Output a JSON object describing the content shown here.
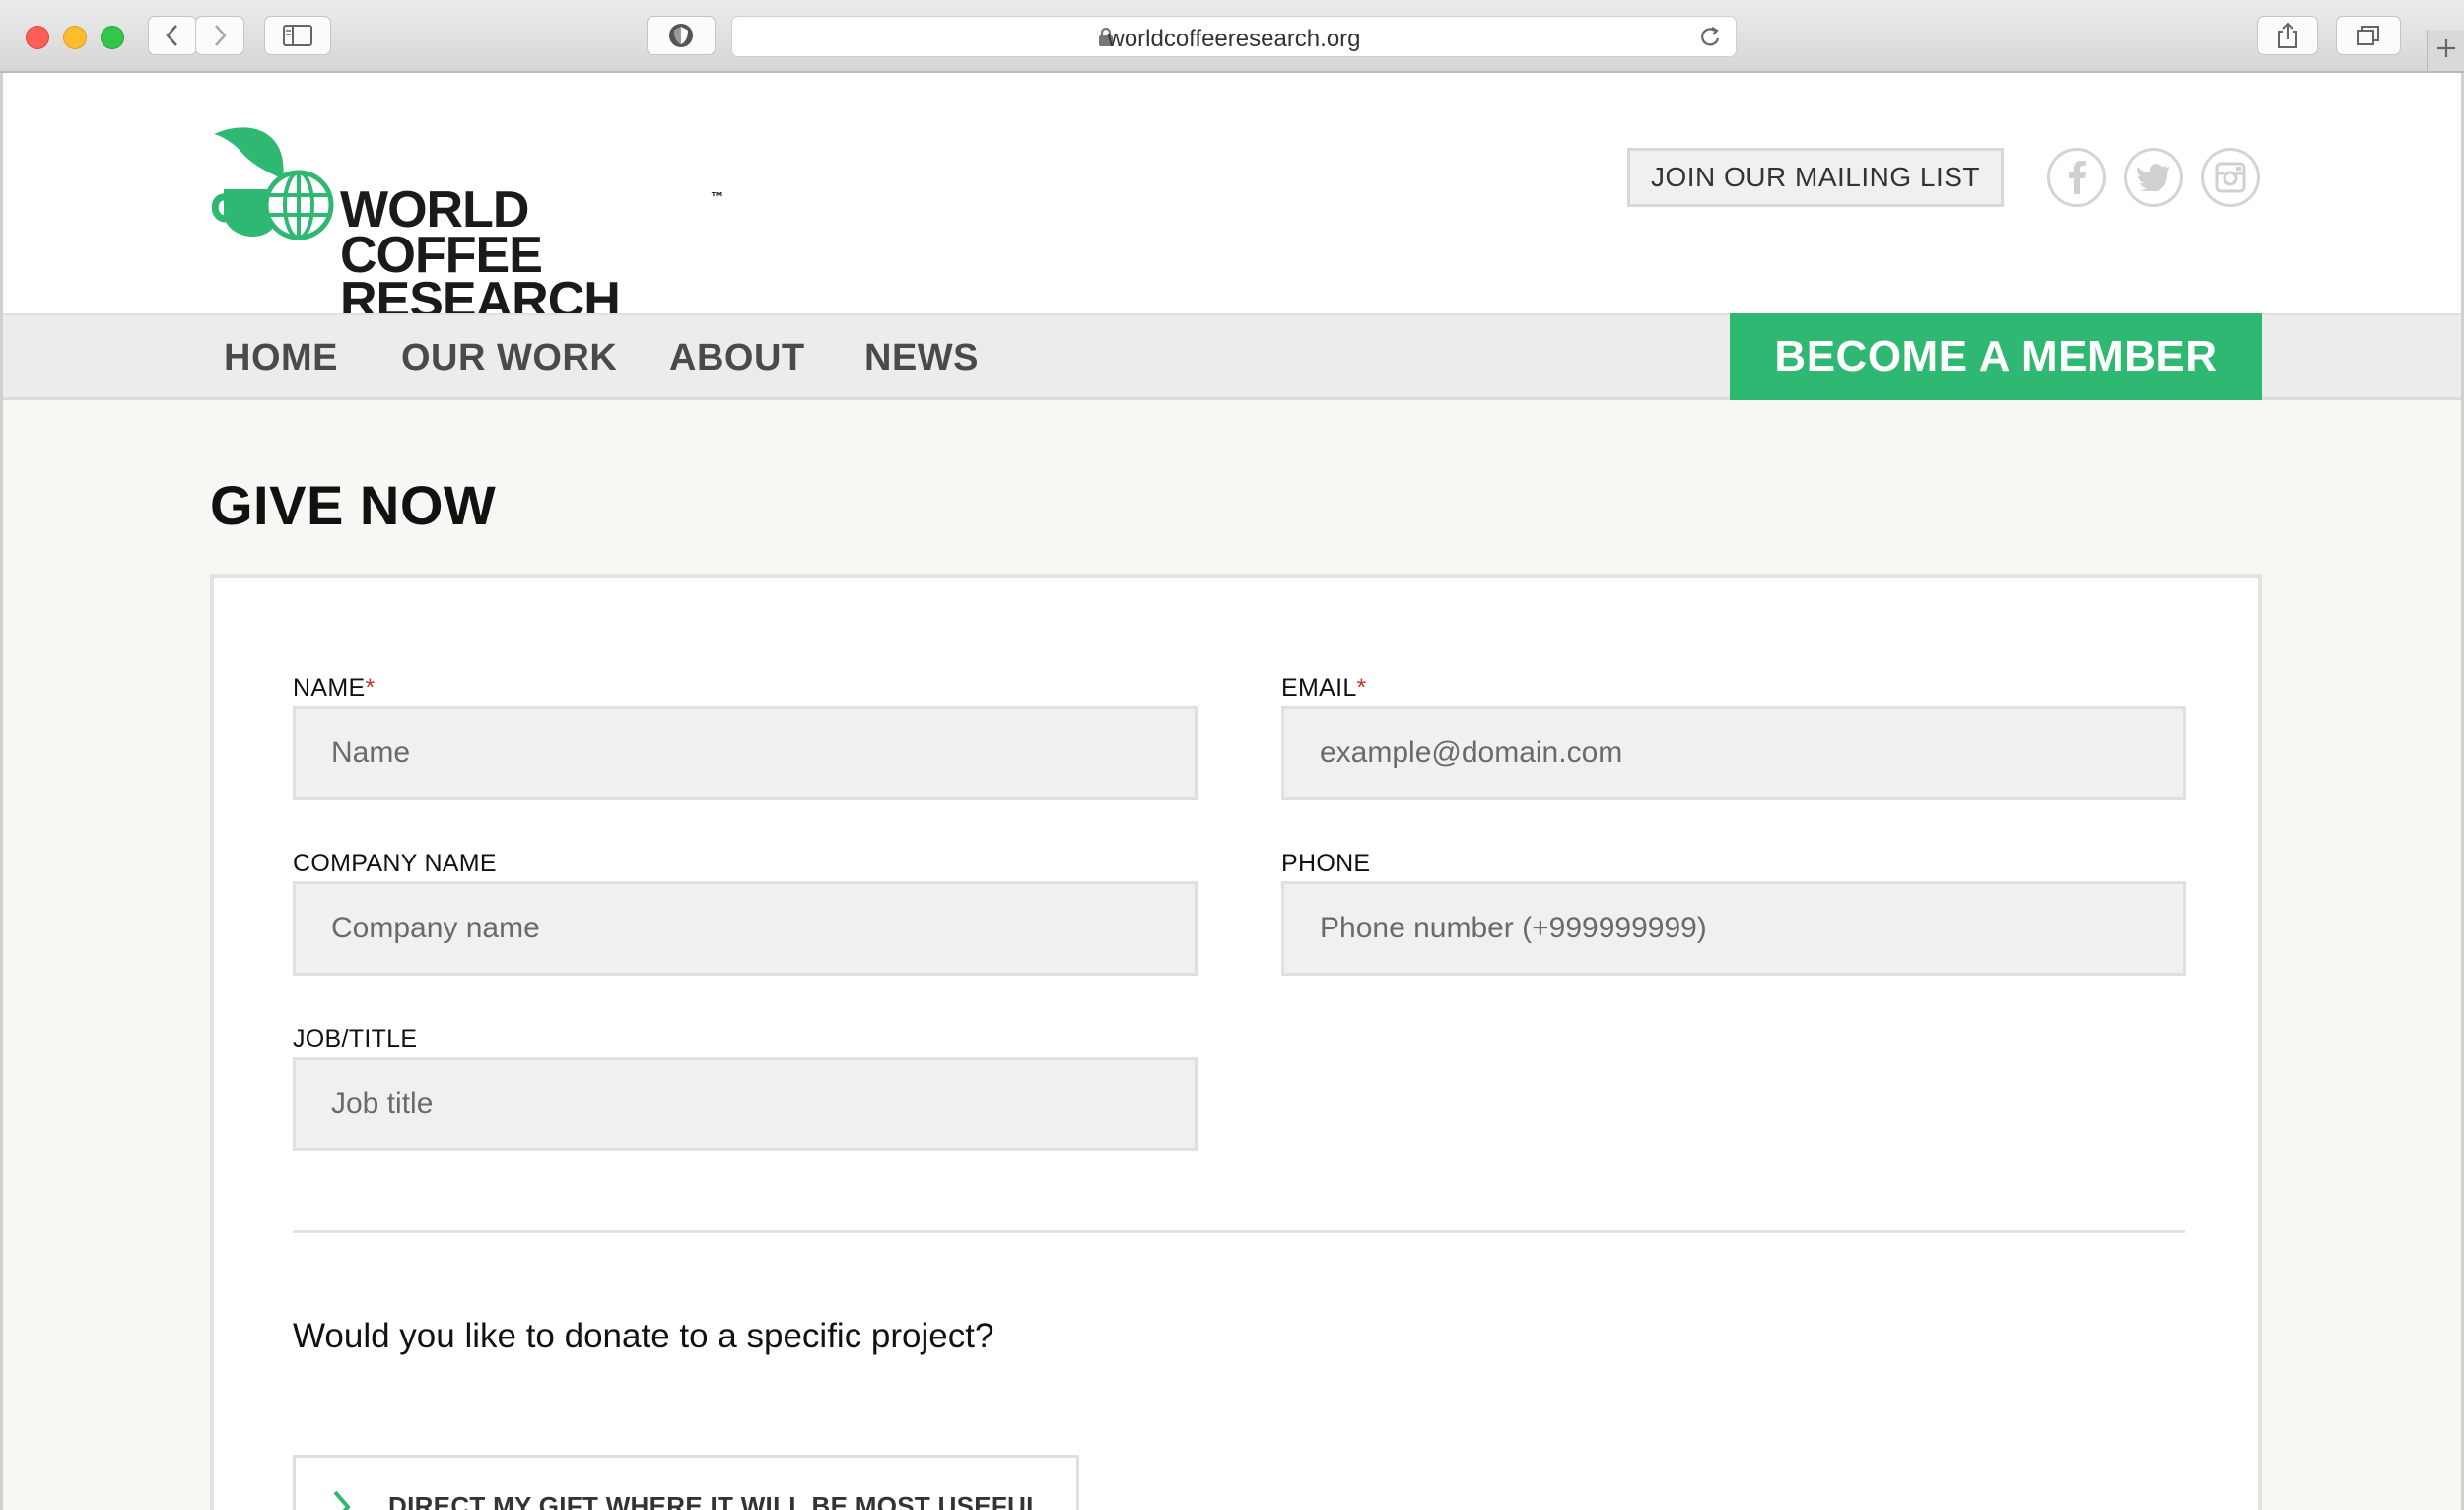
{
  "browser": {
    "url": "worldcoffeeresearch.org",
    "icons": [
      "back-icon",
      "forward-icon",
      "sidebar-icon",
      "shield-icon",
      "lock-icon",
      "reload-icon",
      "share-icon",
      "tabs-icon",
      "plus-icon"
    ]
  },
  "header": {
    "logo_line1": "WORLD COFFEE",
    "logo_line2": "RESEARCH",
    "logo_tm": "™",
    "mailing_label": "JOIN OUR MAILING LIST",
    "social": [
      "facebook-icon",
      "twitter-icon",
      "instagram-icon"
    ]
  },
  "nav": {
    "items": [
      "HOME",
      "OUR WORK",
      "ABOUT",
      "NEWS"
    ],
    "cta": "BECOME A MEMBER"
  },
  "page": {
    "title": "GIVE NOW"
  },
  "form": {
    "name": {
      "label": "NAME",
      "required": "*",
      "placeholder": "Name"
    },
    "email": {
      "label": "EMAIL",
      "required": "*",
      "placeholder": "example@domain.com"
    },
    "company": {
      "label": "COMPANY NAME",
      "placeholder": "Company name"
    },
    "phone": {
      "label": "PHONE",
      "placeholder": "Phone number (+999999999)"
    },
    "job": {
      "label": "JOB/TITLE",
      "placeholder": "Job title"
    },
    "question": "Would you like to donate to a specific project?",
    "gift_button": "DIRECT MY GIFT WHERE IT WILL BE MOST USEFUL"
  },
  "colors": {
    "brand_green": "#2fb872",
    "page_background": "#f7f7f3",
    "nav_background": "#ececec"
  }
}
